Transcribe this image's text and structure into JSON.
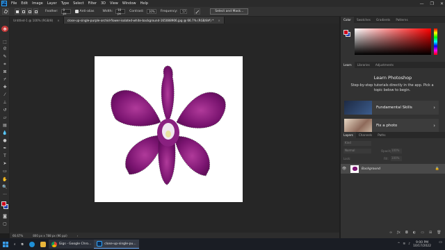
{
  "menubar": {
    "logo": "Ps",
    "items": [
      "File",
      "Edit",
      "Image",
      "Layer",
      "Type",
      "Select",
      "Filter",
      "3D",
      "View",
      "Window",
      "Help"
    ],
    "window_controls": [
      "—",
      "❐",
      "✕"
    ]
  },
  "options": {
    "feather_label": "Feather:",
    "feather_value": "0 px",
    "antialias_label": "Anti-alias",
    "width_label": "Width:",
    "width_value": "10 px",
    "contrast_label": "Contrast:",
    "contrast_value": "10%",
    "frequency_label": "Frequency:",
    "frequency_value": "57",
    "select_mask_label": "Select and Mask..."
  },
  "tabs": [
    {
      "label": "Untitled-1 @ 100% (RGB/8)",
      "close": "×",
      "active": false
    },
    {
      "label": "close-up-single-purple-orchid-flower-isolated-white-background-165088906.jpg @ 66.7% (RGB/8#) *",
      "close": "×",
      "active": true
    }
  ],
  "status": {
    "zoom": "66.67%",
    "doc_size": "800 px x 788 px (96 ppi)"
  },
  "color_panel": {
    "tabs": [
      "Color",
      "Swatches",
      "Gradients",
      "Patterns"
    ],
    "foreground": "#d0021b",
    "background_swatch": "#1f3fb0"
  },
  "learn_panel": {
    "tabs": [
      "Learn",
      "Libraries",
      "Adjustments"
    ],
    "title": "Learn Photoshop",
    "description": "Step-by-step tutorials directly in the app. Pick a topic below to begin.",
    "cards": [
      {
        "label": "Fundamental Skills"
      },
      {
        "label": "Fix a photo"
      }
    ]
  },
  "layers_panel": {
    "tabs": [
      "Layers",
      "Channels",
      "Paths"
    ],
    "kind_label": "Kind",
    "mode_label": "Normal",
    "opacity_label": "Opacity:",
    "opacity_value": "100%",
    "lock_label": "Lock:",
    "fill_label": "Fill:",
    "fill_value": "100%",
    "layers": [
      {
        "name": "Background"
      }
    ]
  },
  "taskbar": {
    "chrome_label": "Gigs - Google Chro...",
    "ps_label": "close-up-single-pu...",
    "time": "9:00 PM",
    "date": "10/17/2022"
  }
}
